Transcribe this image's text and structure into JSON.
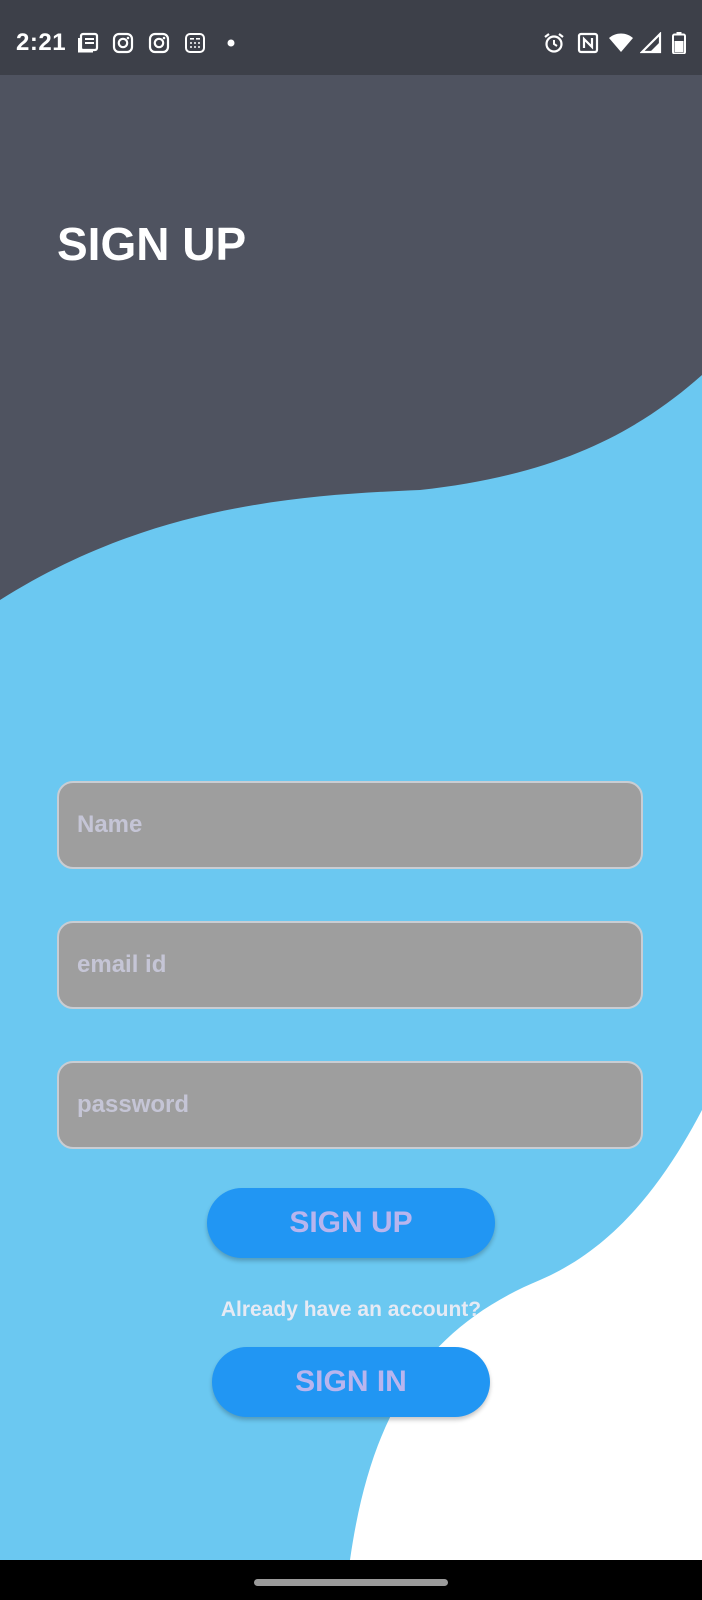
{
  "status_bar": {
    "time": "2:21",
    "left_icons": [
      "news-icon",
      "instagram-icon",
      "instagram-icon",
      "calculator-icon",
      "dot-icon"
    ],
    "right_icons": [
      "alarm-icon",
      "nfc-icon",
      "wifi-icon",
      "signal-icon",
      "battery-icon"
    ]
  },
  "page": {
    "title": "SIGN UP"
  },
  "form": {
    "name_placeholder": "Name",
    "email_placeholder": "email id",
    "password_placeholder": "password",
    "signup_label": "SIGN UP",
    "account_prompt": "Already have an account?",
    "signin_label": "SIGN IN"
  },
  "colors": {
    "status_bar": "#3d4049",
    "header_shape": "#4f5360",
    "background": "#6bc8f1",
    "corner_shape": "#ffffff",
    "input_fill": "#9e9e9e",
    "button_fill": "#2196f3",
    "button_text": "#b8b5ee"
  }
}
